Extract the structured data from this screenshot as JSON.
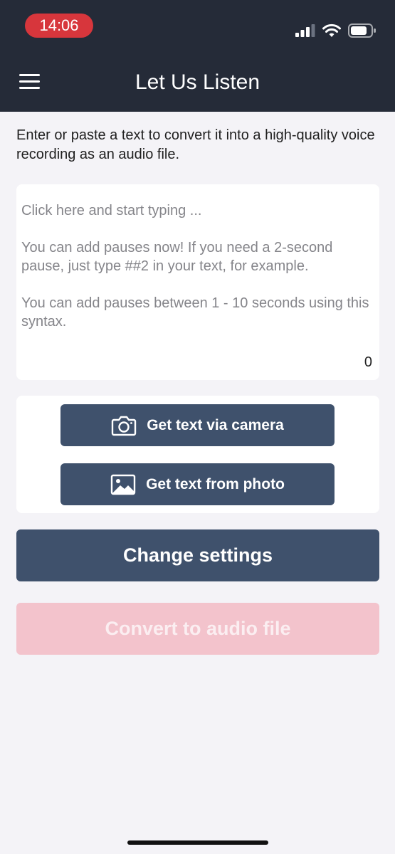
{
  "status_bar": {
    "time": "14:06"
  },
  "header": {
    "title": "Let Us Listen",
    "menu_icon": "hamburger-menu-icon"
  },
  "intro_text": "Enter or paste a text to convert it into a high-quality voice recording as an audio file.",
  "text_input": {
    "placeholder": "Click here and start typing ...\n\nYou can add pauses now! If you need a 2-second pause, just type ##2 in your text, for example.\n\nYou can add pauses between 1 - 10 seconds using this syntax.",
    "value": "",
    "char_count": "0"
  },
  "ocr_buttons": {
    "camera_label": "Get text via camera",
    "camera_icon": "camera-icon",
    "photo_label": "Get text from photo",
    "photo_icon": "image-icon"
  },
  "actions": {
    "settings_label": "Change settings",
    "convert_label": "Convert to audio file"
  },
  "colors": {
    "header_bg": "#252b38",
    "accent_button": "#3f516c",
    "convert_disabled": "#f3c3cc",
    "time_pill": "#d7363c"
  }
}
